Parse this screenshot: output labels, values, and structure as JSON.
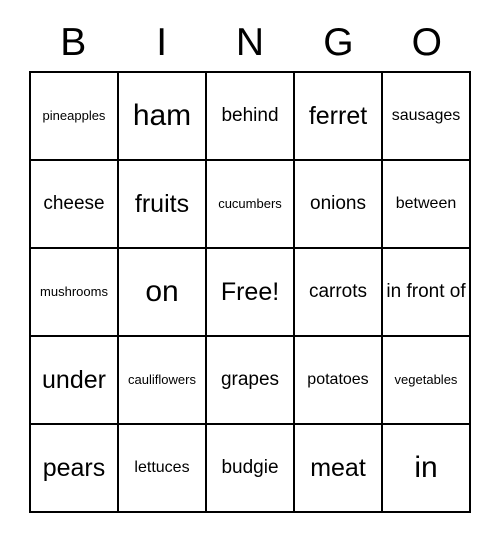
{
  "header": {
    "letters": [
      "B",
      "I",
      "N",
      "G",
      "O"
    ]
  },
  "grid": {
    "rows": [
      [
        {
          "text": "pineapples",
          "size": "sz-s"
        },
        {
          "text": "ham",
          "size": "sz-xxl"
        },
        {
          "text": "behind",
          "size": "sz-l"
        },
        {
          "text": "ferret",
          "size": "sz-xl"
        },
        {
          "text": "sausages",
          "size": "sz-m"
        }
      ],
      [
        {
          "text": "cheese",
          "size": "sz-l"
        },
        {
          "text": "fruits",
          "size": "sz-xl"
        },
        {
          "text": "cucumbers",
          "size": "sz-s"
        },
        {
          "text": "onions",
          "size": "sz-l"
        },
        {
          "text": "between",
          "size": "sz-m"
        }
      ],
      [
        {
          "text": "mushrooms",
          "size": "sz-s"
        },
        {
          "text": "on",
          "size": "sz-xxl"
        },
        {
          "text": "Free!",
          "size": "sz-xl"
        },
        {
          "text": "carrots",
          "size": "sz-l"
        },
        {
          "text": "in front of",
          "size": "sz-l"
        }
      ],
      [
        {
          "text": "under",
          "size": "sz-xl"
        },
        {
          "text": "cauliflowers",
          "size": "sz-s"
        },
        {
          "text": "grapes",
          "size": "sz-l"
        },
        {
          "text": "potatoes",
          "size": "sz-m"
        },
        {
          "text": "vegetables",
          "size": "sz-s"
        }
      ],
      [
        {
          "text": "pears",
          "size": "sz-xl"
        },
        {
          "text": "lettuces",
          "size": "sz-m"
        },
        {
          "text": "budgie",
          "size": "sz-l"
        },
        {
          "text": "meat",
          "size": "sz-xl"
        },
        {
          "text": "in",
          "size": "sz-xxl"
        }
      ]
    ]
  }
}
